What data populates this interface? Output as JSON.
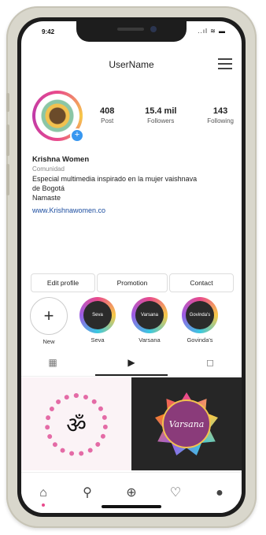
{
  "status": {
    "time": "9:42",
    "icons": "..ıl ≋ ▬"
  },
  "header": {
    "username": "UserName"
  },
  "profile": {
    "posts": {
      "value": "408",
      "label": "Post"
    },
    "followers": {
      "value": "15.4 mil",
      "label": "Followers"
    },
    "following": {
      "value": "143",
      "label": "Following"
    },
    "name": "Krishna Women",
    "category": "Comunidad",
    "bio_line1": "Especial multimedia inspirado en la mujer vaishnava",
    "bio_line2": "de Bogotá",
    "bio_line3": "Namaste",
    "link": "www.Krishnawomen.co"
  },
  "buttons": {
    "edit": "Edit profile",
    "promotion": "Promotion",
    "contact": "Contact"
  },
  "highlights": [
    {
      "label": "New",
      "inner": "+"
    },
    {
      "label": "Seva",
      "inner": "Seva"
    },
    {
      "label": "Varsana",
      "inner": "Varsana"
    },
    {
      "label": "Govinda's",
      "inner": "Govinda's"
    }
  ],
  "grid": {
    "om_symbol": "ॐ",
    "varsana_text": "Varsana"
  },
  "icons": {
    "grid": "▦",
    "reels": "▶",
    "tagged": "◻",
    "home": "⌂",
    "search": "⚲",
    "add": "⊕",
    "heart": "♡",
    "profile": "●"
  },
  "colors": {
    "link": "#1d4ea0",
    "accent": "#e94a8c",
    "badge": "#3897f0"
  }
}
